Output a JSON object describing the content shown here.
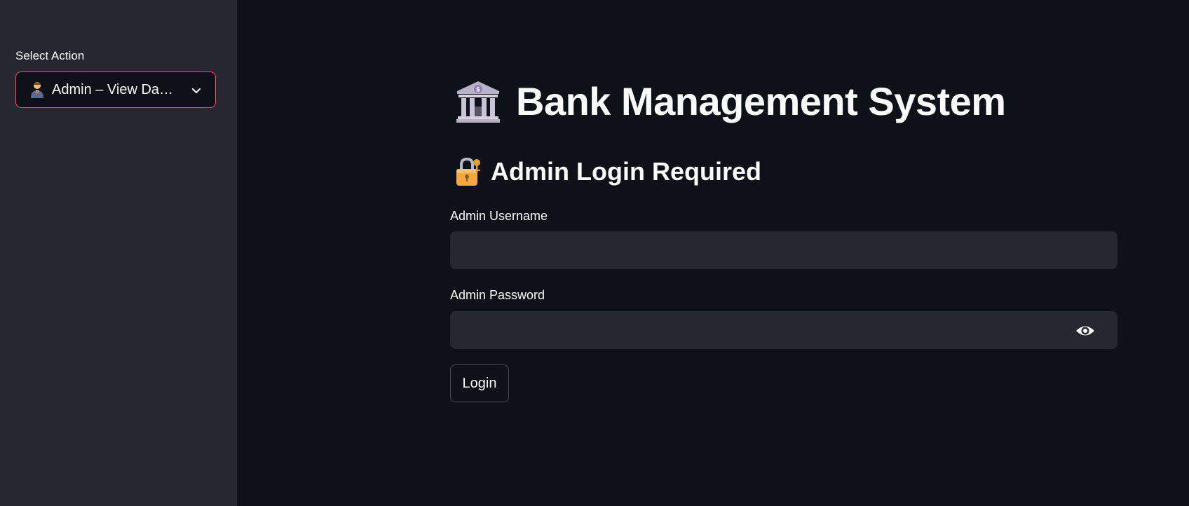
{
  "sidebar": {
    "select_label": "Select Action",
    "select_value": "Admin – View Da…",
    "select_icon": "admin-person-icon"
  },
  "main": {
    "title": "Bank Management System",
    "title_icon": "bank-icon",
    "subtitle": "Admin Login Required",
    "subtitle_icon": "lock-key-icon",
    "username_label": "Admin Username",
    "username_value": "",
    "password_label": "Admin Password",
    "password_value": "",
    "login_label": "Login"
  },
  "colors": {
    "background": "#0e1117",
    "sidebar_bg": "#262730",
    "input_bg": "#262730",
    "accent": "#ff4b4b",
    "text": "#fafafa"
  }
}
